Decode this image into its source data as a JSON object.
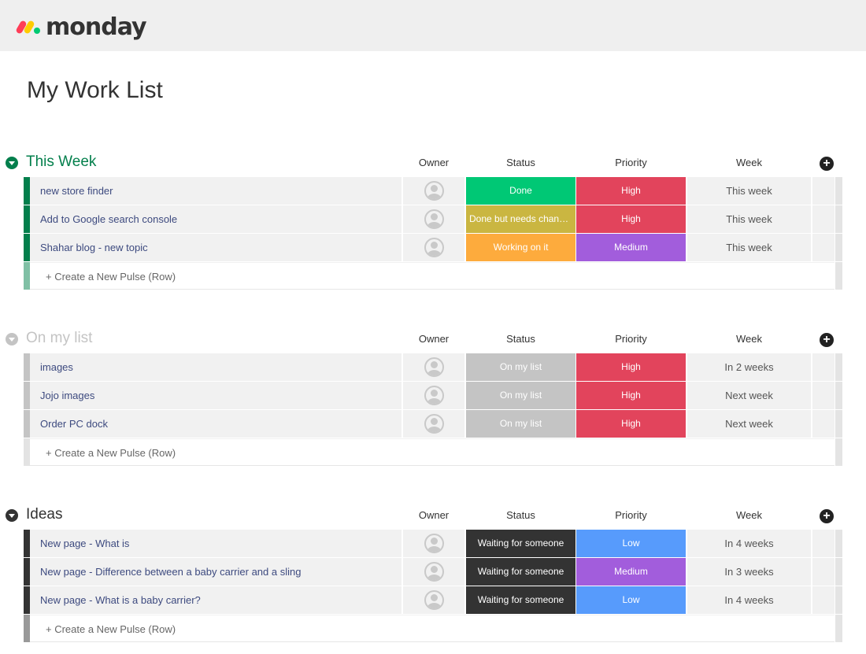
{
  "app": {
    "logo_text": "monday",
    "logo_colors": [
      "#ff3d57",
      "#ffcb00",
      "#00ca72"
    ]
  },
  "page": {
    "title": "My Work List"
  },
  "columns": {
    "owner": "Owner",
    "status": "Status",
    "priority": "Priority",
    "week": "Week"
  },
  "add_column_icon": "+",
  "create_row_label": "+ Create a New Pulse (Row)",
  "groups": [
    {
      "title": "This Week",
      "title_color": "#037f4c",
      "bar_color": "#037f4c",
      "create_bar_color": "#80c0a5",
      "rows": [
        {
          "name": "new store finder",
          "status": "Done",
          "status_color": "#00c875",
          "priority": "High",
          "priority_color": "#e2445c",
          "week": "This week"
        },
        {
          "name": "Add to Google search console",
          "status": "Done but needs changi...",
          "status_color": "#cab641",
          "priority": "High",
          "priority_color": "#e2445c",
          "week": "This week"
        },
        {
          "name": "Shahar blog - new topic",
          "status": "Working on it",
          "status_color": "#fdab3d",
          "priority": "Medium",
          "priority_color": "#a25ddc",
          "week": "This week"
        }
      ]
    },
    {
      "title": "On my list",
      "title_color": "#c4c4c4",
      "bar_color": "#c4c4c4",
      "create_bar_color": "#e3e3e3",
      "rows": [
        {
          "name": "images",
          "status": "On my list",
          "status_color": "#c4c4c4",
          "priority": "High",
          "priority_color": "#e2445c",
          "week": "In 2 weeks"
        },
        {
          "name": "Jojo images",
          "status": "On my list",
          "status_color": "#c4c4c4",
          "priority": "High",
          "priority_color": "#e2445c",
          "week": "Next week"
        },
        {
          "name": "Order PC dock",
          "status": "On my list",
          "status_color": "#c4c4c4",
          "priority": "High",
          "priority_color": "#e2445c",
          "week": "Next week"
        }
      ]
    },
    {
      "title": "Ideas",
      "title_color": "#333333",
      "bar_color": "#333333",
      "create_bar_color": "#999999",
      "rows": [
        {
          "name": "New page - What is",
          "status": "Waiting for someone",
          "status_color": "#333333",
          "priority": "Low",
          "priority_color": "#579bfc",
          "week": "In 4 weeks"
        },
        {
          "name": "New page - Difference between a baby carrier and a sling",
          "status": "Waiting for someone",
          "status_color": "#333333",
          "priority": "Medium",
          "priority_color": "#a25ddc",
          "week": "In 3 weeks"
        },
        {
          "name": "New page - What is a baby carrier?",
          "status": "Waiting for someone",
          "status_color": "#333333",
          "priority": "Low",
          "priority_color": "#579bfc",
          "week": "In 4 weeks"
        }
      ]
    }
  ]
}
